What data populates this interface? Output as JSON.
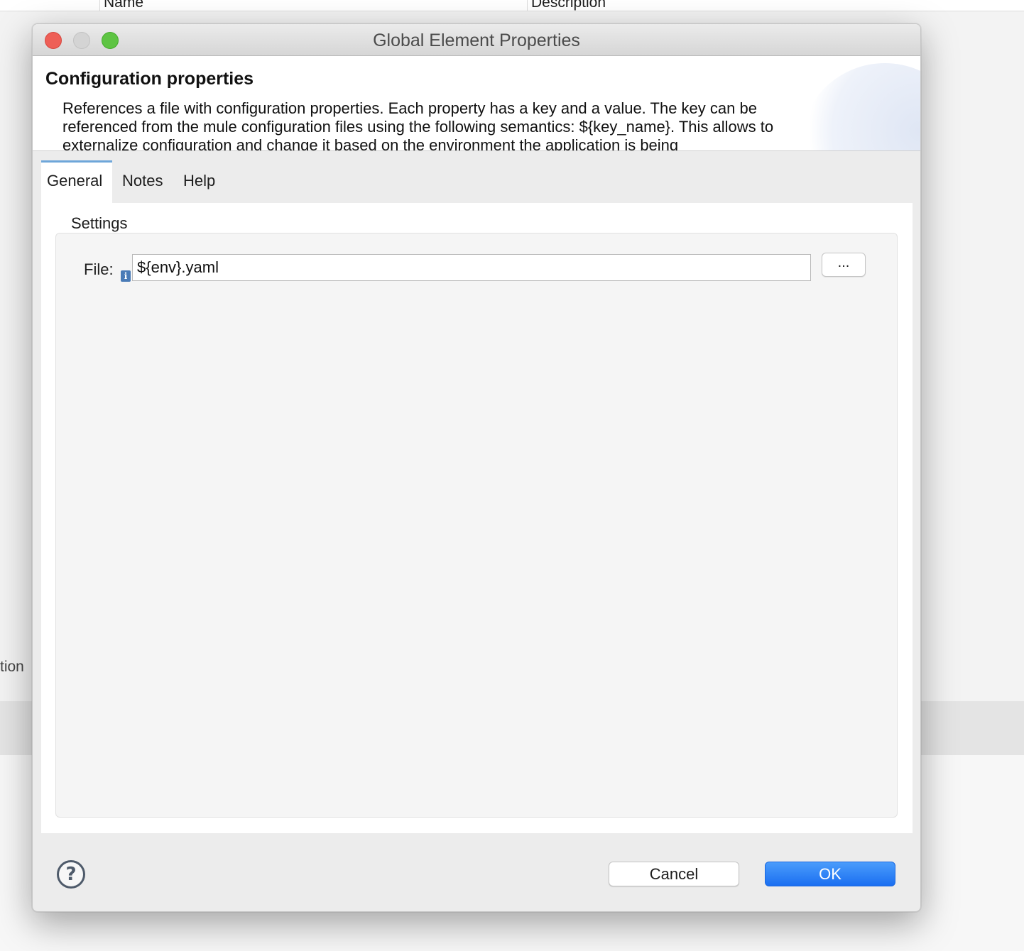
{
  "background": {
    "columns": [
      "Name",
      "Description"
    ],
    "side_text": "tion"
  },
  "dialog": {
    "title": "Global Element Properties",
    "header": {
      "title": "Configuration properties",
      "description": "References a file with configuration properties. Each property has a key and a value. The key can be referenced from the mule configuration files using the following semantics: ${key_name}. This allows to externalize configuration and change it based on the environment the application is being"
    },
    "tabs": [
      {
        "label": "General",
        "active": true
      },
      {
        "label": "Notes",
        "active": false
      },
      {
        "label": "Help",
        "active": false
      }
    ],
    "settings": {
      "group_label": "Settings",
      "file_label": "File:",
      "file_value": "${env}.yaml",
      "info_icon": "info-icon",
      "browse_label": "..."
    },
    "footer": {
      "help_icon": "question-circle-icon",
      "cancel_label": "Cancel",
      "ok_label": "OK"
    },
    "colors": {
      "close": "#ee5f57",
      "minimize": "#d4d4d4",
      "maximize": "#5ec443",
      "ok_button": "#1b6ff1",
      "active_tab_indicator": "#6ea6d9"
    }
  }
}
